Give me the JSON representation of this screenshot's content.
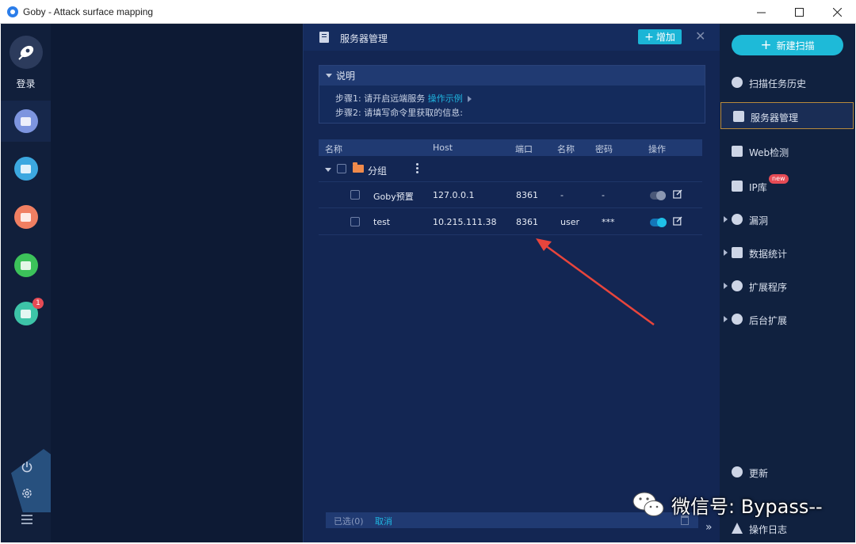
{
  "window": {
    "title": "Goby - Attack surface mapping",
    "controls": [
      "minimize-icon",
      "maximize-icon",
      "close-icon"
    ]
  },
  "left_sidebar": {
    "login_label": "登录",
    "nav": [
      {
        "icon": "overview-icon",
        "color": "#7d95df"
      },
      {
        "icon": "asset-icon",
        "color": "#3ca8e0"
      },
      {
        "icon": "vulnerability-icon",
        "color": "#f07f62"
      },
      {
        "icon": "report-icon",
        "color": "#3cc25a"
      },
      {
        "icon": "plugin-icon",
        "color": "#3dc4a8",
        "badge": "1"
      }
    ],
    "utilities": [
      "power-icon",
      "settings-icon",
      "menu-icon"
    ]
  },
  "server_panel": {
    "title": "服务器管理",
    "add_label": "增加",
    "description": {
      "header": "说明",
      "step1": "步骤1: 请开启远端服务",
      "step1_link": "操作示例",
      "step2": "步骤2: 请填写命令里获取的信息:"
    },
    "columns": [
      "名称",
      "Host",
      "端口",
      "名称",
      "密码",
      "操作"
    ],
    "group": {
      "name": "分组"
    },
    "rows": [
      {
        "name": "Goby预置",
        "host": "127.0.0.1",
        "port": "8361",
        "user": "-",
        "password": "-",
        "enabled": false
      },
      {
        "name": "test",
        "host": "10.215.111.38",
        "port": "8361",
        "user": "user",
        "password": "***",
        "enabled": true
      }
    ],
    "footer": {
      "selected": "已选(0)",
      "cancel": "取消"
    }
  },
  "right_sidebar": {
    "new_scan_label": "新建扫描",
    "menu": [
      {
        "label": "扫描任务历史",
        "icon": "history-icon"
      },
      {
        "label": "服务器管理",
        "icon": "server-icon",
        "active": true
      },
      {
        "label": "Web检测",
        "icon": "monitor-icon"
      },
      {
        "label": "IP库",
        "icon": "ip-icon",
        "badge": "new"
      },
      {
        "label": "漏洞",
        "icon": "bug-icon",
        "expandable": true
      },
      {
        "label": "数据统计",
        "icon": "bar-chart-icon",
        "expandable": true
      },
      {
        "label": "扩展程序",
        "icon": "puzzle-icon",
        "expandable": true
      },
      {
        "label": "后台扩展",
        "icon": "puzzle-gear-icon",
        "expandable": true
      }
    ],
    "bottom": [
      {
        "label": "更新",
        "icon": "refresh-icon"
      },
      {
        "label": "操作日志",
        "icon": "warning-icon"
      }
    ]
  },
  "watermark": {
    "text": "微信号: Bypass--"
  },
  "colors": {
    "accent": "#1ebad8",
    "panel_bg": "#132653",
    "arrow": "#e8453c"
  }
}
